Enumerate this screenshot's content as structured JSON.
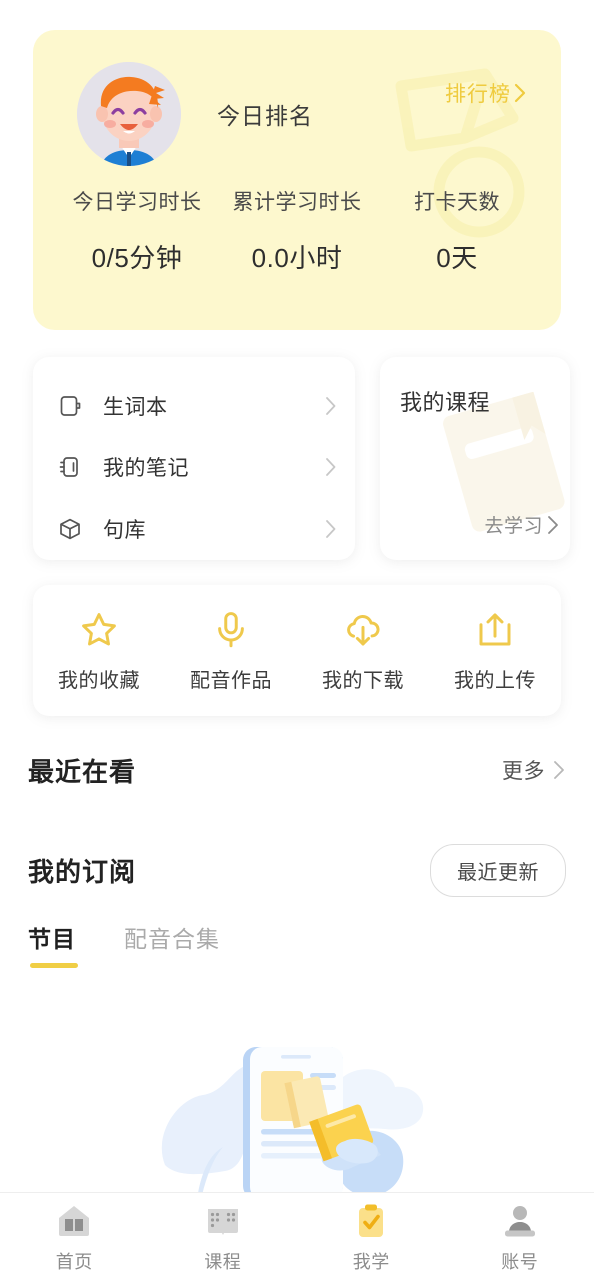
{
  "theme": {
    "hero_bg": "#FDF8CE",
    "accent": "#EFCB3F",
    "page_bg": "#FFFFFF",
    "text_primary": "#222222",
    "text_muted": "#8C8C8C"
  },
  "hero": {
    "avatar_icon": "boy-avatar-icon",
    "title": "今日排名",
    "rank_link": "排行榜",
    "rank_chevron_icon": "chevron-right-icon",
    "watermark_icon": "medal-watermark-icon",
    "stats": [
      {
        "label": "今日学习时长",
        "value": "0/5分钟"
      },
      {
        "label": "累计学习时长",
        "value": "0.0小时"
      },
      {
        "label": "打卡天数",
        "value": "0天"
      }
    ]
  },
  "menu_card": {
    "items": [
      {
        "icon": "vocabulary-book-icon",
        "label": "生词本",
        "chevron_icon": "chevron-right-icon"
      },
      {
        "icon": "notebook-icon",
        "label": "我的笔记",
        "chevron_icon": "chevron-right-icon"
      },
      {
        "icon": "box-icon",
        "label": "句库",
        "chevron_icon": "chevron-right-icon"
      }
    ]
  },
  "course_card": {
    "title": "我的课程",
    "go_label": "去学习",
    "go_chevron_icon": "chevron-right-icon",
    "watermark_icon": "book-watermark-icon"
  },
  "quick_actions": [
    {
      "icon": "star-icon",
      "label": "我的收藏"
    },
    {
      "icon": "microphone-icon",
      "label": "配音作品"
    },
    {
      "icon": "cloud-download-icon",
      "label": "我的下载"
    },
    {
      "icon": "upload-icon",
      "label": "我的上传"
    }
  ],
  "recent_section": {
    "title": "最近在看",
    "more_label": "更多",
    "more_chevron_icon": "chevron-right-icon"
  },
  "subscription_section": {
    "title": "我的订阅",
    "filter_label": "最近更新",
    "tabs": [
      {
        "label": "节目",
        "active": true
      },
      {
        "label": "配音合集",
        "active": false
      }
    ],
    "empty_illustration_icon": "empty-phone-cards-illustration"
  },
  "bottom_nav": [
    {
      "icon": "home-book-icon",
      "label": "首页",
      "active": false
    },
    {
      "icon": "course-book-icon",
      "label": "课程",
      "active": false
    },
    {
      "icon": "clipboard-check-icon",
      "label": "我学",
      "active": true
    },
    {
      "icon": "person-icon",
      "label": "账号",
      "active": false
    }
  ]
}
